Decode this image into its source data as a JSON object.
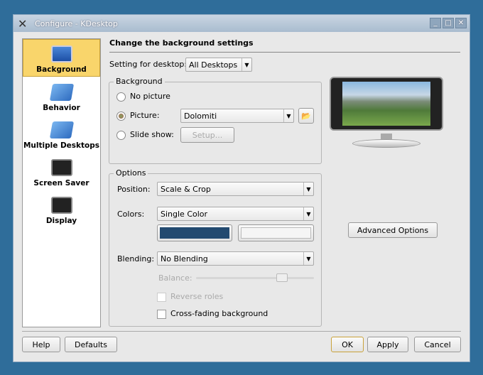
{
  "window": {
    "title": "Configure - KDesktop"
  },
  "sidebar": {
    "items": [
      {
        "label": "Background"
      },
      {
        "label": "Behavior"
      },
      {
        "label": "Multiple Desktops"
      },
      {
        "label": "Screen Saver"
      },
      {
        "label": "Display"
      }
    ]
  },
  "main": {
    "heading": "Change the background settings",
    "desktop_label": "Setting for desktop:",
    "desktop_value": "All Desktops",
    "background": {
      "title": "Background",
      "no_picture": "No picture",
      "picture": "Picture:",
      "picture_value": "Dolomiti",
      "slide_show": "Slide show:",
      "setup": "Setup..."
    },
    "options": {
      "title": "Options",
      "position_label": "Position:",
      "position_value": "Scale & Crop",
      "colors_label": "Colors:",
      "colors_value": "Single Color",
      "color1": "#234a70",
      "color2": "#f5f5f5",
      "blending_label": "Blending:",
      "blending_value": "No Blending",
      "balance_label": "Balance:",
      "balance_value": 0.75,
      "reverse_roles": "Reverse roles",
      "cross_fading": "Cross-fading background"
    },
    "advanced": "Advanced Options"
  },
  "footer": {
    "help": "Help",
    "defaults": "Defaults",
    "ok": "OK",
    "apply": "Apply",
    "cancel": "Cancel"
  }
}
